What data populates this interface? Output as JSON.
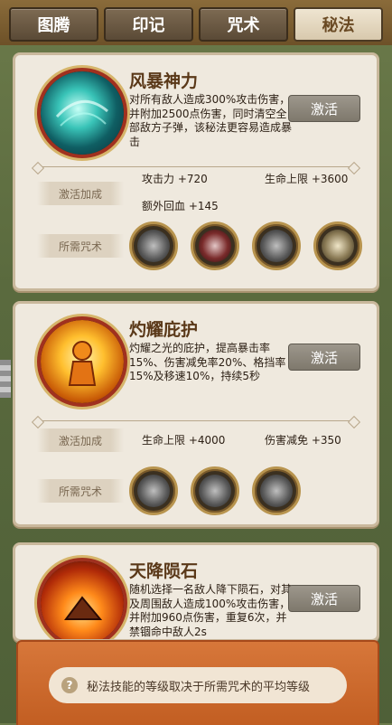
{
  "tabs": [
    {
      "label": "图腾",
      "active": false
    },
    {
      "label": "印记",
      "active": false
    },
    {
      "label": "咒术",
      "active": false
    },
    {
      "label": "秘法",
      "active": true
    }
  ],
  "skills": [
    {
      "name": "风暴神力",
      "description": "对所有敌人造成300%攻击伤害，并附加2500点伤害，同时清空全部敌方子弹，该秘法更容易造成暴击",
      "button": "激活",
      "bonus_label": "激活加成",
      "bonuses": [
        "攻击力 +720",
        "生命上限 +3600",
        "额外回血 +145"
      ],
      "spells_label": "所需咒术",
      "spell_icons": [
        "beast-fang-icon",
        "crimson-claw-icon",
        "storm-wing-icon",
        "light-burst-icon"
      ]
    },
    {
      "name": "灼耀庇护",
      "description": "灼耀之光的庇护，提高暴击率15%、伤害减免率20%、格挡率15%及移速10%，持续5秒",
      "button": "激活",
      "bonus_label": "激活加成",
      "bonuses": [
        "生命上限 +4000",
        "伤害减免 +350"
      ],
      "spells_label": "所需咒术",
      "spell_icons": [
        "wolf-head-icon",
        "feather-wing-icon",
        "serpent-coil-icon"
      ]
    },
    {
      "name": "天降陨石",
      "description": "随机选择一名敌人降下陨石，对其及周围敌人造成100%攻击伤害，并附加960点伤害，重复6次，并禁锢命中敌人2s",
      "button": "激活"
    }
  ],
  "footer": {
    "tip": "秘法技能的等级取决于所需咒术的平均等级"
  },
  "colors": {
    "accent_red": "#a0311f",
    "card_bg": "#efe9de",
    "banner": "#c25e22",
    "title_brown": "#5a3818"
  }
}
